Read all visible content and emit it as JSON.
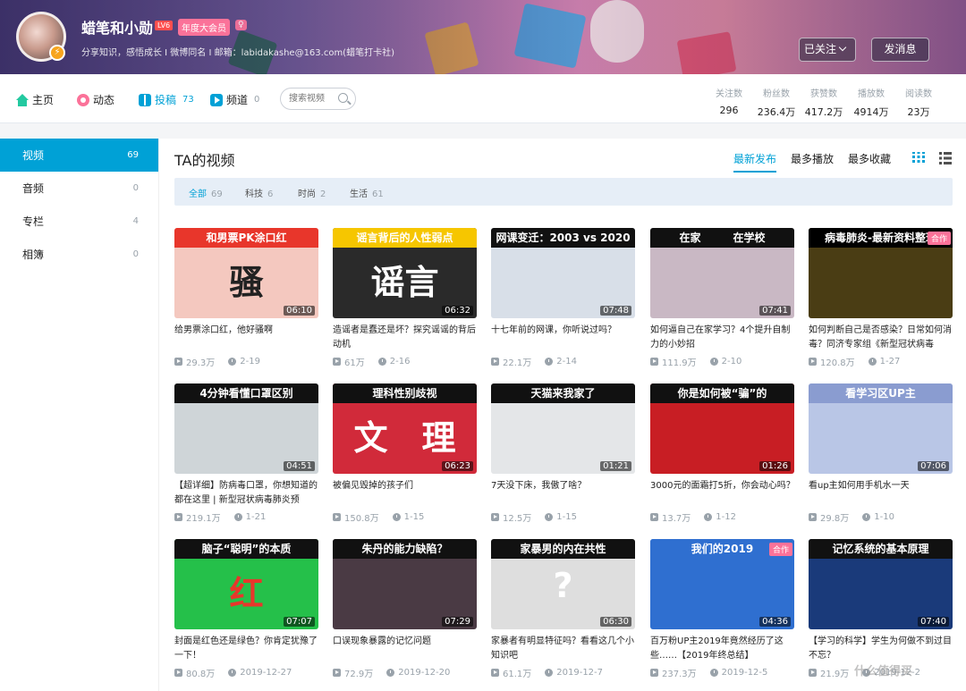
{
  "user": {
    "name": "蜡笔和小勋",
    "level": "LV6",
    "vip": "年度大会员",
    "gender": "♀",
    "sign": "分享知识，感悟成长 I 微博同名 I 邮箱：labidakashe@163.com(蜡笔打卡社)",
    "follow_label": "已关注",
    "message_label": "发消息"
  },
  "nav": {
    "home": "主页",
    "dynamic": "动态",
    "submissions": "投稿",
    "submissions_count": "73",
    "channels": "频道",
    "channels_count": "0",
    "search_placeholder": "搜索视频"
  },
  "stats": [
    {
      "label": "关注数",
      "value": "296"
    },
    {
      "label": "粉丝数",
      "value": "236.4万"
    },
    {
      "label": "获赞数",
      "value": "417.2万"
    },
    {
      "label": "播放数",
      "value": "4914万"
    },
    {
      "label": "阅读数",
      "value": "23万"
    }
  ],
  "sidebar": [
    {
      "label": "视频",
      "count": "69"
    },
    {
      "label": "音频",
      "count": "0"
    },
    {
      "label": "专栏",
      "count": "4"
    },
    {
      "label": "相簿",
      "count": "0"
    }
  ],
  "main": {
    "title": "TA的视频",
    "sort": [
      "最新发布",
      "最多播放",
      "最多收藏"
    ],
    "filters": [
      {
        "label": "全部",
        "count": "69"
      },
      {
        "label": "科技",
        "count": "6"
      },
      {
        "label": "时尚",
        "count": "2"
      },
      {
        "label": "生活",
        "count": "61"
      }
    ]
  },
  "videos": [
    {
      "caption": "和男票PK涂口红",
      "big": "骚",
      "duration": "06:10",
      "title": "给男票涂口红，他好骚啊",
      "plays": "29.3万",
      "date": "2-19",
      "bg": "#f4c8bf",
      "capbg": "#e8362b"
    },
    {
      "caption": "谣言背后的人性弱点",
      "big": "谣言",
      "duration": "06:32",
      "title": "造谣者是蠢还是坏？探究谣谣的背后动机",
      "plays": "61万",
      "date": "2-16",
      "bg": "#2a2a2a",
      "capbg": "#f6c600"
    },
    {
      "caption": "网课变迁：2003 vs 2020",
      "big": "",
      "duration": "07:48",
      "title": "十七年前的网课，你听说过吗？",
      "plays": "22.1万",
      "date": "2-14",
      "bg": "#d8dfe8",
      "capbg": "#111111"
    },
    {
      "caption": "在家　　　在学校",
      "big": "",
      "duration": "07:41",
      "title": "如何逼自己在家学习？4个提升自制力的小妙招",
      "plays": "111.9万",
      "date": "2-10",
      "bg": "#c9b8c4",
      "capbg": "#111111"
    },
    {
      "caption": "病毒肺炎-最新资料整理",
      "big": "",
      "duration": "",
      "title": "如何判断自己是否感染？日常如何消毒？同济专家组《新型冠状病毒",
      "plays": "120.8万",
      "date": "1-27",
      "bg": "#4a3d14",
      "capbg": "#000000",
      "tag": "合作"
    },
    {
      "caption": "4分钟看懂口罩区别",
      "big": "",
      "duration": "04:51",
      "title": "【超详细】防病毒口罩，你想知道的都在这里 | 新型冠状病毒肺炎预",
      "plays": "219.1万",
      "date": "1-21",
      "bg": "#cfd5d8",
      "capbg": "#111111"
    },
    {
      "caption": "理科性别歧视",
      "big": "文　理",
      "duration": "06:23",
      "title": "被偏见毁掉的孩子们",
      "plays": "150.8万",
      "date": "1-15",
      "bg": "#d12a3a",
      "capbg": "#111111"
    },
    {
      "caption": "天猫来我家了",
      "big": "",
      "duration": "01:21",
      "title": "7天没下床，我傲了啥？",
      "plays": "12.5万",
      "date": "1-15",
      "bg": "#e4e6e8",
      "capbg": "#111111"
    },
    {
      "caption": "你是如何被“骗”的",
      "big": "",
      "duration": "01:26",
      "title": "3000元的面霜打5折，你会动心吗？",
      "plays": "13.7万",
      "date": "1-12",
      "bg": "#c81e24",
      "capbg": "#111111"
    },
    {
      "caption": "看学习区UP主",
      "big": "",
      "duration": "07:06",
      "title": "看up主如何用手机水一天",
      "plays": "29.8万",
      "date": "1-10",
      "bg": "#b9c6e6",
      "capbg": "#8a9cd0"
    },
    {
      "caption": "脑子“聪明”的本质",
      "big": "红",
      "duration": "07:07",
      "title": "封面是红色还是绿色？你肯定犹豫了一下！",
      "plays": "80.8万",
      "date": "2019-12-27",
      "bg": "#25c04a",
      "capbg": "#111111"
    },
    {
      "caption": "朱丹的能力缺陷？",
      "big": "",
      "duration": "07:29",
      "title": "口误现象暴露的记忆问题",
      "plays": "72.9万",
      "date": "2019-12-20",
      "bg": "#4a3a44",
      "capbg": "#111111"
    },
    {
      "caption": "家暴男的内在共性",
      "big": "?",
      "duration": "06:30",
      "title": "家暴者有明显特征吗？看看这几个小知识吧",
      "plays": "61.1万",
      "date": "2019-12-7",
      "bg": "#dedede",
      "capbg": "#111111"
    },
    {
      "caption": "我们的2019",
      "big": "",
      "duration": "04:36",
      "title": "百万粉UP主2019年竟然经历了这些……【2019年终总结】",
      "plays": "237.3万",
      "date": "2019-12-5",
      "bg": "#2f6fd0",
      "capbg": "#2f6fd0",
      "tag": "合作"
    },
    {
      "caption": "记忆系统的基本原理",
      "big": "",
      "duration": "07:40",
      "title": "【学习的科学】学生为何做不到过目不忘？",
      "plays": "21.9万",
      "date": "2019-12-2",
      "bg": "#1a3a7a",
      "capbg": "#111111"
    }
  ],
  "watermark": "什么值得买"
}
